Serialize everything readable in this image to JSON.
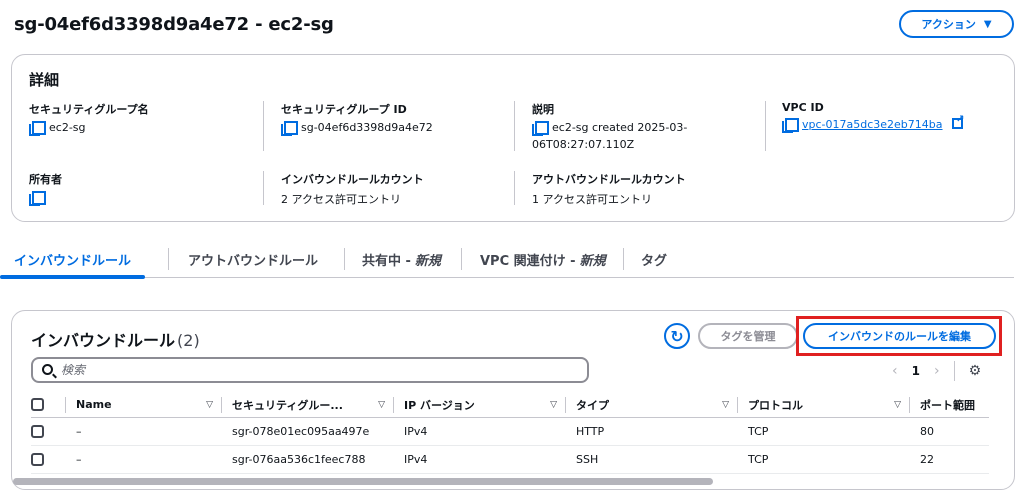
{
  "header": {
    "title": "sg-04ef6d3398d9a4e72 - ec2-sg",
    "actions_label": "アクション"
  },
  "details": {
    "title": "詳細",
    "fields": {
      "sg_name": {
        "label": "セキュリティグループ名",
        "value": "ec2-sg"
      },
      "sg_id": {
        "label": "セキュリティグループ ID",
        "value": "sg-04ef6d3398d9a4e72"
      },
      "description": {
        "label": "説明",
        "value_line1": "ec2-sg created 2025-03-",
        "value_line2": "06T08:27:07.110Z"
      },
      "vpc_id": {
        "label": "VPC ID",
        "value": "vpc-017a5dc3e2eb714ba"
      },
      "owner": {
        "label": "所有者",
        "value": ""
      },
      "inbound_count": {
        "label": "インバウンドルールカウント",
        "value": "2 アクセス許可エントリ"
      },
      "outbound_count": {
        "label": "アウトバウンドルールカウント",
        "value": "1 アクセス許可エントリ"
      }
    }
  },
  "tabs": [
    {
      "label": "インバウンドルール",
      "active": true
    },
    {
      "label": "アウトバウンドルール"
    },
    {
      "label": "共有中 -",
      "tag": "新規"
    },
    {
      "label": "VPC 関連付け -",
      "tag": "新規"
    },
    {
      "label": "タグ"
    }
  ],
  "rules": {
    "title": "インバウンドルール",
    "count": "(2)",
    "manage_tags_label": "タグを管理",
    "edit_label": "インバウンドのルールを編集",
    "search_placeholder": "検索",
    "page": "1",
    "columns": [
      "Name",
      "セキュリティグルー...",
      "IP バージョン",
      "タイプ",
      "プロトコル",
      "ポート範囲"
    ],
    "rows": [
      {
        "name": "–",
        "rule_id": "sgr-078e01ec095aa497e",
        "ip_version": "IPv4",
        "type": "HTTP",
        "protocol": "TCP",
        "port": "80"
      },
      {
        "name": "–",
        "rule_id": "sgr-076aa536c1feec788",
        "ip_version": "IPv4",
        "type": "SSH",
        "protocol": "TCP",
        "port": "22"
      }
    ]
  },
  "icons": {
    "copy": "copy-icon",
    "external_link": "external-link-icon",
    "refresh": "refresh-icon",
    "search": "search-icon",
    "settings": "gear-icon"
  },
  "colors": {
    "accent": "#006ce0",
    "highlight": "#e02020",
    "border": "#c6c6cd"
  }
}
